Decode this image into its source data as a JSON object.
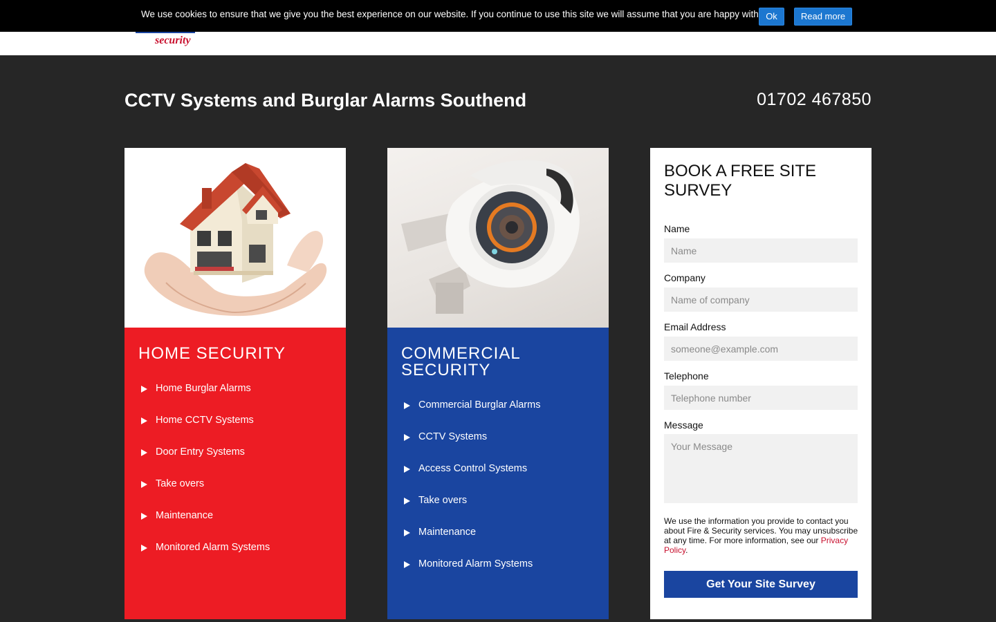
{
  "header": {
    "logo_word": "security"
  },
  "cookie_bar": {
    "message": "We use cookies to ensure that we give you the best experience on our website. If you continue to use this site we will assume that you are happy with it.",
    "ok_label": "Ok",
    "read_more_label": "Read more"
  },
  "page": {
    "title": "CCTV Systems and Burglar Alarms Southend",
    "phone": "01702 467850"
  },
  "home": {
    "heading": "HOME SECURITY",
    "items": [
      "Home Burglar Alarms",
      "Home CCTV Systems",
      "Door Entry Systems",
      "Take overs",
      "Maintenance",
      "Monitored Alarm Systems"
    ]
  },
  "commercial": {
    "heading": "COMMERCIAL SECURITY",
    "items": [
      "Commercial Burglar Alarms",
      "CCTV Systems",
      "Access Control Systems",
      "Take overs",
      "Maintenance",
      "Monitored Alarm Systems"
    ]
  },
  "form": {
    "title": "BOOK A FREE SITE SURVEY",
    "name_label": "Name",
    "name_placeholder": "Name",
    "company_label": "Company",
    "company_placeholder": "Name of company",
    "email_label": "Email Address",
    "email_placeholder": "someone@example.com",
    "phone_label": "Telephone",
    "phone_placeholder": "Telephone number",
    "message_label": "Message",
    "message_placeholder": "Your Message",
    "note_text": "We use the information you provide to contact you about Fire & Security services. You may unsubscribe at any time. For more information, see our ",
    "privacy_link": "Privacy Policy",
    "note_end": ".",
    "submit_label": "Get Your Site Survey"
  },
  "colors": {
    "home_red": "#ed1c24",
    "commercial_blue": "#1a45a0",
    "background": "#262626",
    "cookie_button": "#1c77d0"
  }
}
